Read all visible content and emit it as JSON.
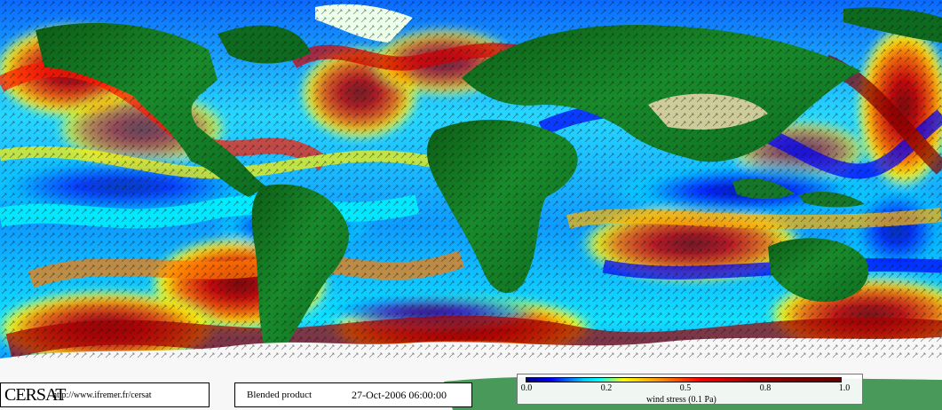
{
  "map": {
    "legend": {
      "org": "CERSAT",
      "url": "http://www.ifremer.fr/cersat",
      "product": "Blended product",
      "datetime": "27-Oct-2006 06:00:00",
      "scale_title": "wind stress (0.1 Pa)",
      "ticks": [
        "0.0",
        "0.2",
        "0.5",
        "0.8",
        "1.0"
      ]
    },
    "colors": {
      "ocean_base": "#14a9ff",
      "low": "#0000ff",
      "mid": "#00ffff",
      "high": "#ff0000",
      "very_high": "#7f0000",
      "land": "#137b25",
      "ice": "#f7f7f7"
    }
  }
}
